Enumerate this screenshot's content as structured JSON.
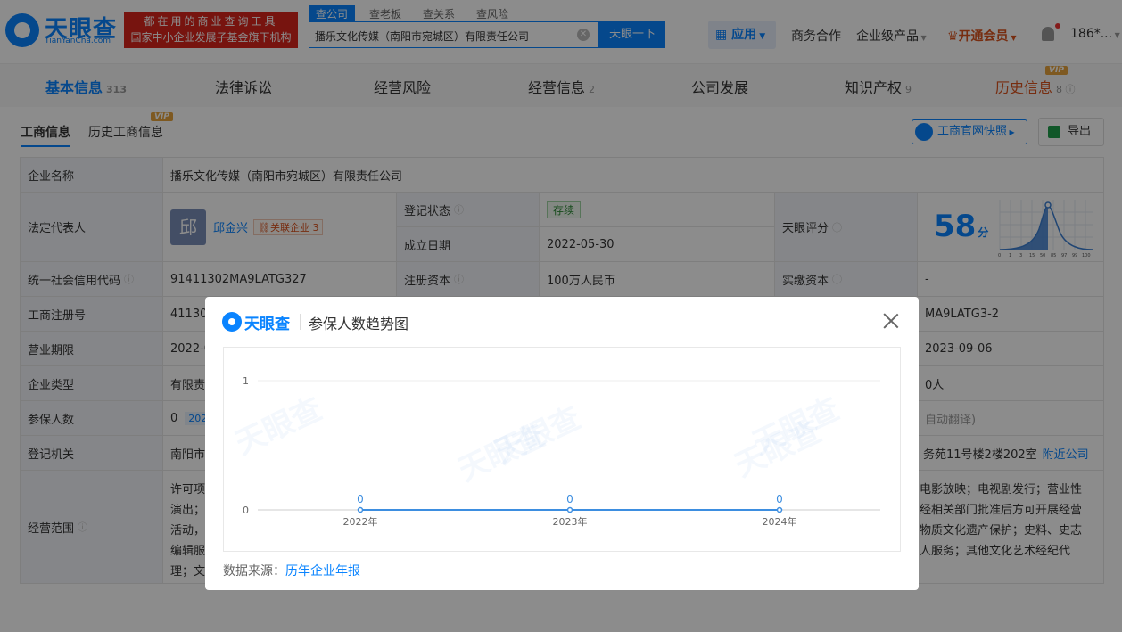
{
  "header": {
    "logo_name": "天眼查",
    "logo_sub": "TianYanCha.com",
    "slogan_line1": "都在用的商业查询工具",
    "slogan_line2": "国家中小企业发展子基金旗下机构",
    "search_tabs": [
      "查公司",
      "查老板",
      "查关系",
      "查风险"
    ],
    "search_value": "播乐文化传媒（南阳市宛城区）有限责任公司",
    "search_button": "天眼一下",
    "nav_app": "应用",
    "nav_business": "商务合作",
    "nav_enterprise": "企业级产品",
    "nav_vip": "开通会员",
    "nav_user": "186*..."
  },
  "main_tabs": [
    {
      "label": "基本信息",
      "count": "313"
    },
    {
      "label": "法律诉讼",
      "count": ""
    },
    {
      "label": "经营风险",
      "count": ""
    },
    {
      "label": "经营信息",
      "count": "2"
    },
    {
      "label": "公司发展",
      "count": ""
    },
    {
      "label": "知识产权",
      "count": "9"
    },
    {
      "label": "历史信息",
      "count": "8"
    }
  ],
  "vip_label": "VIP",
  "sub_tabs": [
    "工商信息",
    "历史工商信息"
  ],
  "buttons": {
    "gs_snapshot": "工商官网快照",
    "export": "导出"
  },
  "table": {
    "company_name_label": "企业名称",
    "company_name": "播乐文化传媒（南阳市宛城区）有限责任公司",
    "legal_rep_label": "法定代表人",
    "legal_rep_avatar": "邱",
    "legal_rep": "邱金兴",
    "related_label": "关联企业",
    "related_count": "3",
    "status_label": "登记状态",
    "status": "存续",
    "founded_label": "成立日期",
    "founded": "2022-05-30",
    "score_label": "天眼评分",
    "score": "58",
    "score_unit": "分",
    "credit_code_label": "统一社会信用代码",
    "credit_code": "91411302MA9LATG327",
    "reg_capital_label": "注册资本",
    "reg_capital": "100万人民币",
    "paid_capital_label": "实缴资本",
    "paid_capital": "-",
    "reg_no_label": "工商注册号",
    "reg_no_partial": "41130",
    "org_code_partial": "MA9LATG3-2",
    "term_label": "营业期限",
    "term_partial": "2022-0",
    "approve_date_partial": "2023-09-06",
    "type_label": "企业类型",
    "type_partial": "有限责",
    "staff_partial": "0人",
    "insured_label": "参保人数",
    "insured_value": "0",
    "insured_year_partial": "202",
    "auto_translate_partial": "自动翻译)",
    "authority_label": "登记机关",
    "authority_partial": "南阳市",
    "address_partial": "务苑11号楼2楼202室",
    "nearby": "附近公司",
    "scope_label": "经营范围",
    "scope_left": [
      "许可项",
      "演出；",
      "活动，",
      "编辑服",
      "理；文"
    ],
    "scope_right": [
      "电影放映；电视剧发行；营业性",
      "经相关部门批准后方可开展经营",
      "物质文化遗产保护；史料、史志",
      "人服务；其他文化艺术经纪代",
      ""
    ]
  },
  "modal": {
    "brand": "天眼查",
    "title": "参保人数趋势图",
    "source_label": "数据来源：",
    "source_link": "历年企业年报",
    "watermark": "天眼查"
  },
  "chart_data": {
    "type": "line",
    "categories": [
      "2022年",
      "2023年",
      "2024年"
    ],
    "series": [
      {
        "values": [
          0,
          0,
          0
        ]
      }
    ],
    "yticks": [
      0,
      1
    ],
    "ylim": [
      0,
      1
    ],
    "colors": {
      "line": "#3d8ee0"
    }
  },
  "score_chart_ticks": [
    "0",
    "1",
    "3",
    "15",
    "50",
    "85",
    "97",
    "99",
    "100"
  ]
}
